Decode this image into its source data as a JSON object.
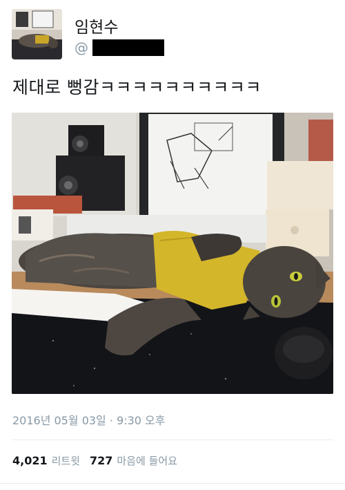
{
  "author": {
    "display_name": "임현수",
    "handle_prefix": "@"
  },
  "tweet": {
    "text": "제대로 뻥감ㅋㅋㅋㅋㅋㅋㅋㅋㅋㅋ",
    "timestamp": "2016년 05월 03일 · 9:30 오후"
  },
  "stats": {
    "retweets_count": "4,021",
    "retweets_label": "리트윗",
    "likes_count": "727",
    "likes_label": "마음에 들어요"
  },
  "media": {
    "description_icon": "photo-cat-on-desk"
  }
}
